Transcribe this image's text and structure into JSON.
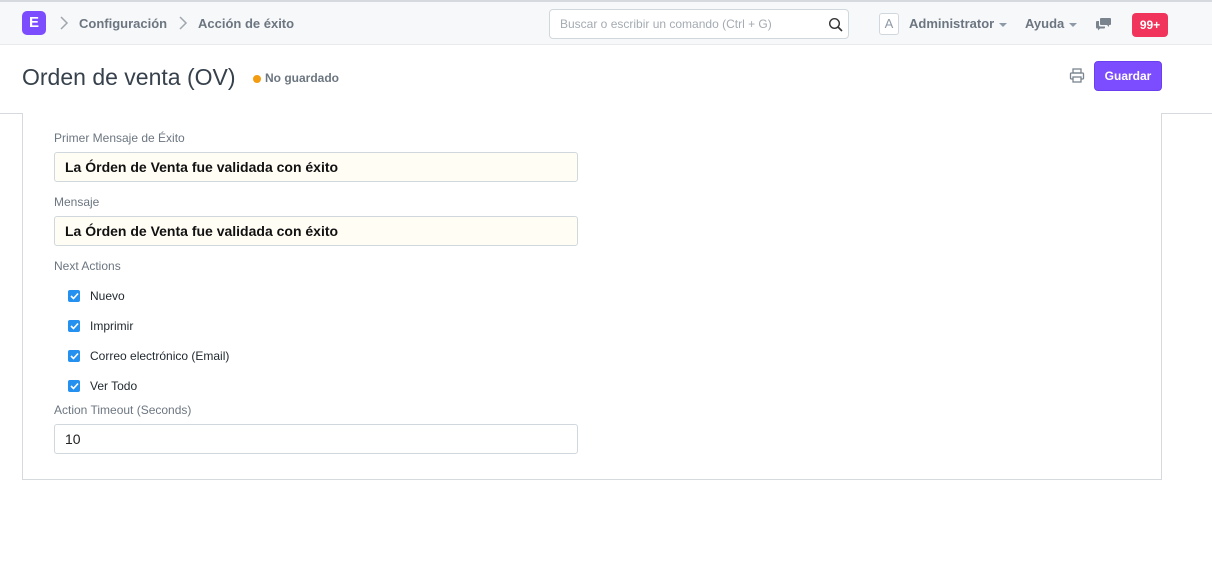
{
  "navbar": {
    "logo_letter": "E",
    "breadcrumbs": [
      "Configuración",
      "Acción de éxito"
    ],
    "search_placeholder": "Buscar o escribir un comando (Ctrl + G)",
    "avatar_letter": "A",
    "user_label": "Administrator",
    "help_label": "Ayuda",
    "notifications_count": "99+"
  },
  "page": {
    "title": "Orden de venta (OV)",
    "status": "No guardado",
    "save_label": "Guardar"
  },
  "form": {
    "first_success_label": "Primer Mensaje de Éxito",
    "first_success_value": "La Órden de Venta fue validada con éxito",
    "message_label": "Mensaje",
    "message_value": "La Órden de Venta fue validada con éxito",
    "next_actions_label": "Next Actions",
    "next_actions": [
      {
        "label": "Nuevo",
        "checked": true
      },
      {
        "label": "Imprimir",
        "checked": true
      },
      {
        "label": "Correo electrónico (Email)",
        "checked": true
      },
      {
        "label": "Ver Todo",
        "checked": true
      }
    ],
    "timeout_label": "Action Timeout (Seconds)",
    "timeout_value": "10"
  },
  "colors": {
    "accent": "#7c4dff",
    "badge": "#f0345b",
    "checkbox": "#2490ef",
    "status_dot": "#f39c12"
  },
  "icons": [
    "search-icon",
    "chevron-right-icon",
    "chat-icon",
    "printer-icon",
    "check-icon"
  ]
}
